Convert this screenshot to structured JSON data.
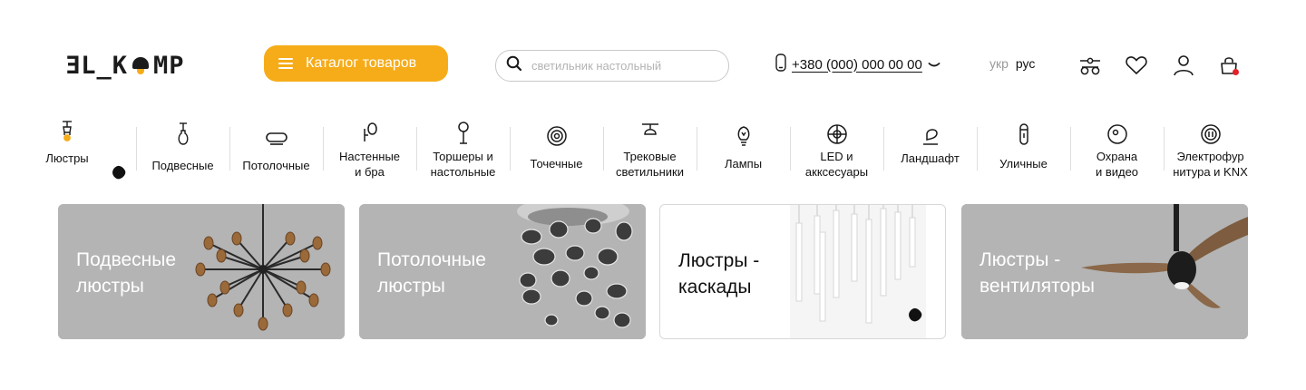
{
  "header": {
    "logo_text_left": "ƎL_K",
    "logo_text_right": "MP",
    "catalog_label": "Каталог товаров",
    "search_placeholder": "светильник настольный",
    "phone": "+380 (000) 000 00 00",
    "lang_inactive": "укр",
    "lang_active": "рус",
    "icons": [
      "compare-icon",
      "heart-icon",
      "user-icon",
      "cart-icon"
    ],
    "accent_color": "#f6ac19",
    "cart_badge_color": "#e5202a"
  },
  "categories": [
    {
      "label": "Люстры",
      "icon": "chandelier-icon"
    },
    {
      "label": "Подвесные",
      "icon": "pendant-icon"
    },
    {
      "label": "Потолочные",
      "icon": "ceiling-icon"
    },
    {
      "label": "Настенные\nи бра",
      "icon": "wall-lamp-icon"
    },
    {
      "label": "Торшеры и\nнастольные",
      "icon": "floor-lamp-icon"
    },
    {
      "label": "Точечные",
      "icon": "spot-icon"
    },
    {
      "label": "Трековые\nсветильники",
      "icon": "track-icon"
    },
    {
      "label": "Лампы",
      "icon": "bulb-icon"
    },
    {
      "label": "LED и\nакксесуары",
      "icon": "led-icon"
    },
    {
      "label": "Ландшафт",
      "icon": "landscape-icon"
    },
    {
      "label": "Уличные",
      "icon": "street-icon"
    },
    {
      "label": "Охрана\nи видео",
      "icon": "security-icon"
    },
    {
      "label": "Электрофур\nнитура и KNX",
      "icon": "electrical-icon"
    }
  ],
  "promo_cards": [
    {
      "title": "Подвесные\nлюстры",
      "image": "sputnik-chandelier"
    },
    {
      "title": "Потолочные\nлюстры",
      "image": "chrome-drops-chandelier"
    },
    {
      "title": "Люстры -\nкаскады",
      "image": "cascade-tubes"
    },
    {
      "title": "Люстры -\nвентиляторы",
      "image": "ceiling-fan"
    }
  ]
}
